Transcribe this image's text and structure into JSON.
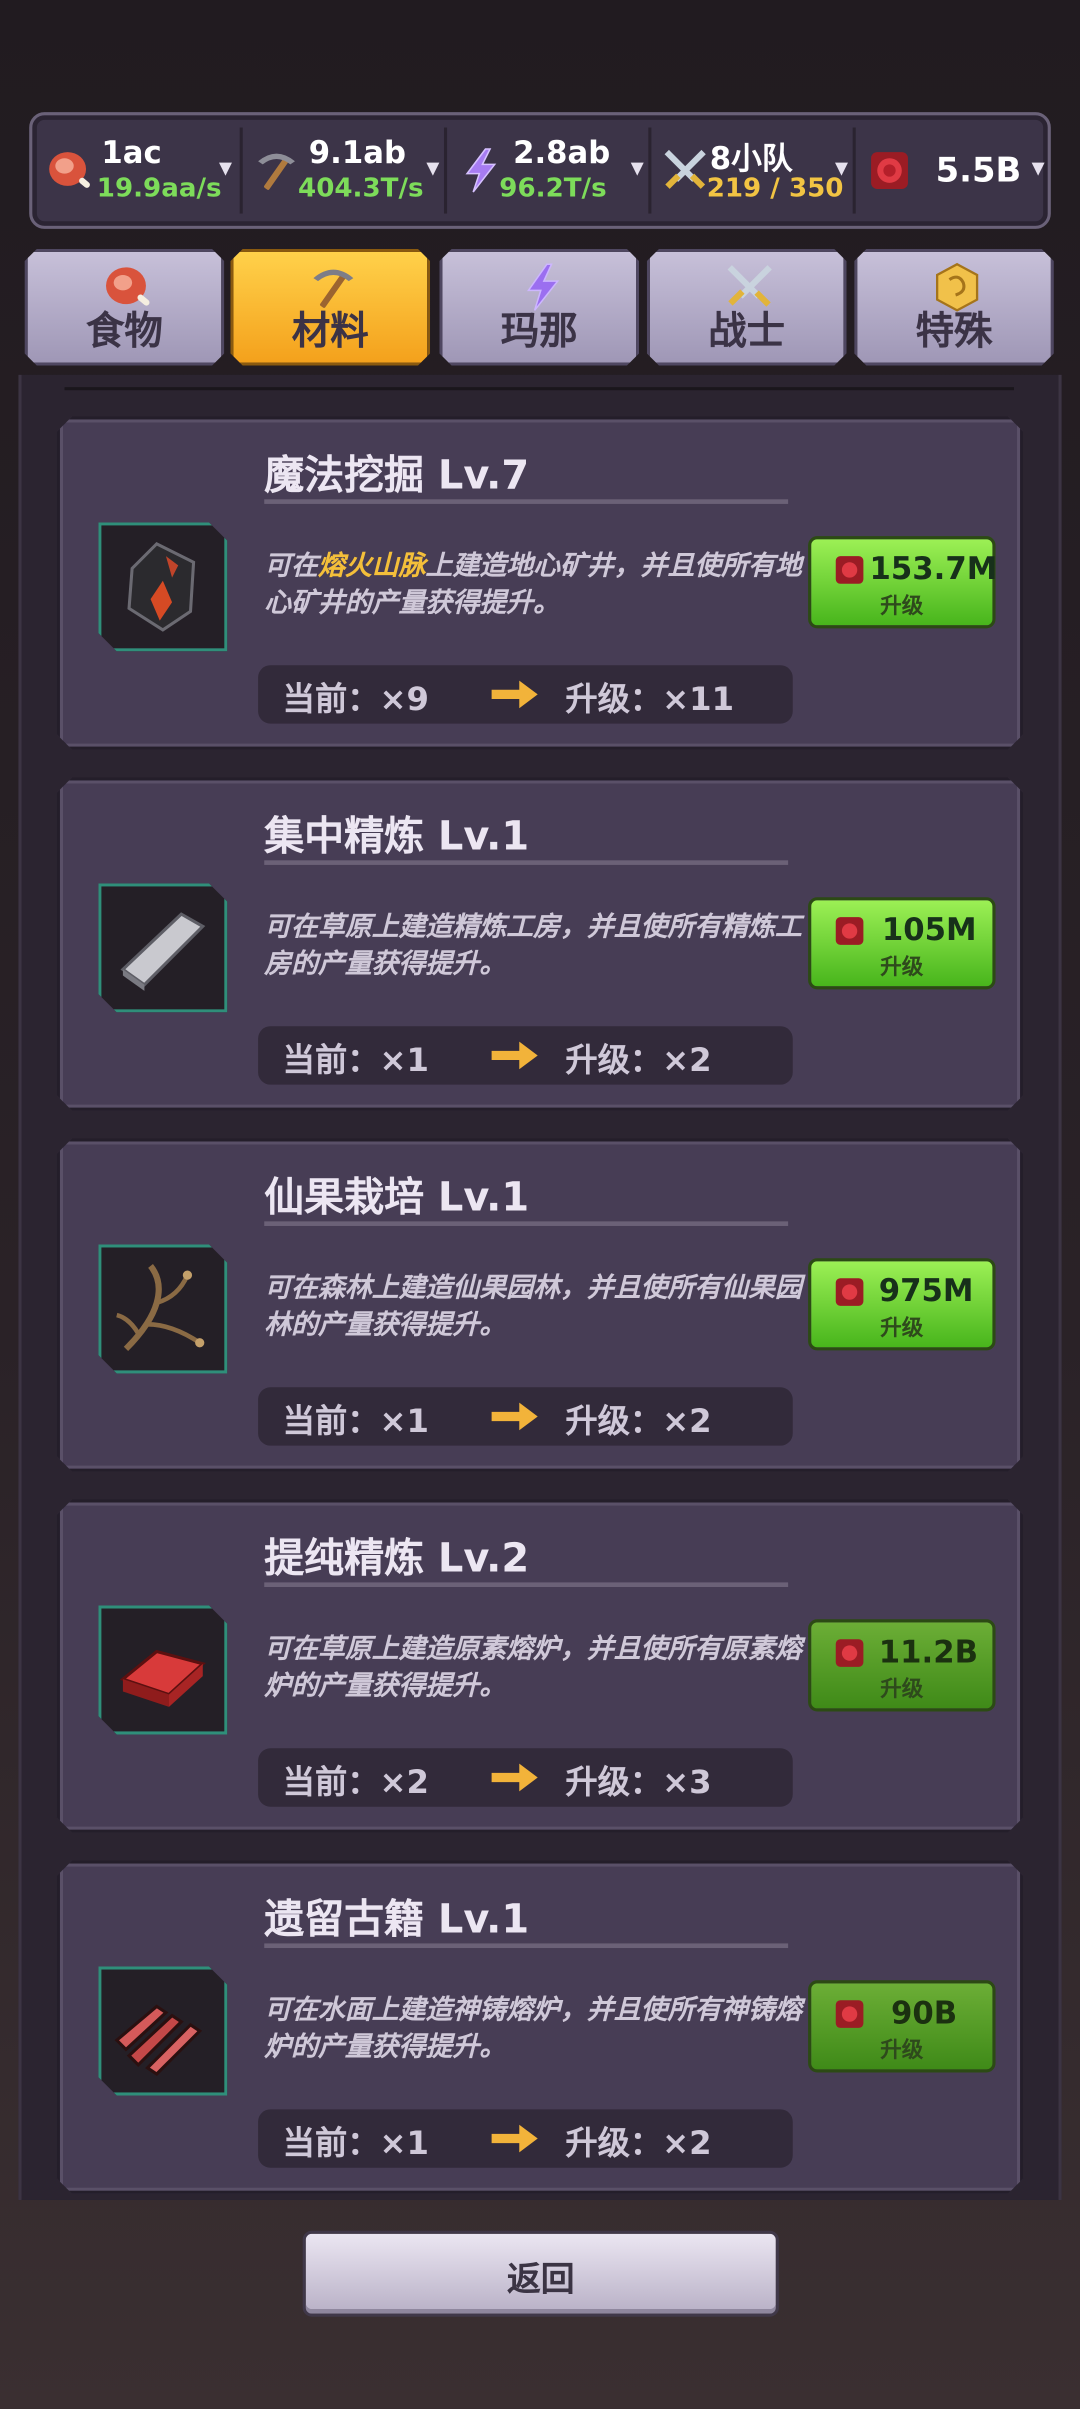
{
  "resources": [
    {
      "icon": "meat-icon",
      "amount": "1ac",
      "rate": "19.9aa/s",
      "rate_color": "#7ddc5a"
    },
    {
      "icon": "pickaxe-icon",
      "amount": "9.1ab",
      "rate": "404.3T/s",
      "rate_color": "#7ddc5a"
    },
    {
      "icon": "lightning-icon",
      "amount": "2.8ab",
      "rate": "96.2T/s",
      "rate_color": "#7ddc5a"
    },
    {
      "icon": "crossed-swords-icon",
      "amount": "8小队",
      "rate": "219 / 350",
      "rate_color": "#f2c443"
    },
    {
      "icon": "red-gem-icon",
      "amount": "5.5B",
      "rate": "",
      "rate_color": "#7ddc5a"
    }
  ],
  "tabs": [
    {
      "icon": "meat-icon",
      "label": "食物",
      "active": false
    },
    {
      "icon": "pickaxe-icon",
      "label": "材料",
      "active": true
    },
    {
      "icon": "lightning-icon",
      "label": "玛那",
      "active": false
    },
    {
      "icon": "crossed-swords-icon",
      "label": "战士",
      "active": false
    },
    {
      "icon": "gold-coin-icon",
      "label": "特殊",
      "active": false
    }
  ],
  "upgrades": [
    {
      "title": "魔法挖掘 Lv.7",
      "icon": "black-ore-icon",
      "desc_pre": "可在",
      "desc_highlight": "熔火山脉",
      "desc_post": "上建造地心矿井，并且使所有地心矿井的产量获得提升。",
      "current": "当前：×9",
      "next": "升级：×11",
      "price": "153.7M",
      "button_label": "升级",
      "affordable": true
    },
    {
      "title": "集中精炼 Lv.1",
      "icon": "metal-bar-icon",
      "desc_pre": "可在草原上建造精炼工房，并且使所有精炼工房的产量获得提升。",
      "desc_highlight": "",
      "desc_post": "",
      "current": "当前：×1",
      "next": "升级：×2",
      "price": "105M",
      "button_label": "升级",
      "affordable": true
    },
    {
      "title": "仙果栽培 Lv.1",
      "icon": "branch-icon",
      "desc_pre": "可在森林上建造仙果园林，并且使所有仙果园林的产量获得提升。",
      "desc_highlight": "",
      "desc_post": "",
      "current": "当前：×1",
      "next": "升级：×2",
      "price": "975M",
      "button_label": "升级",
      "affordable": true
    },
    {
      "title": "提纯精炼 Lv.2",
      "icon": "red-ingot-icon",
      "desc_pre": "可在草原上建造原素熔炉，并且使所有原素熔炉的产量获得提升。",
      "desc_highlight": "",
      "desc_post": "",
      "current": "当前：×2",
      "next": "升级：×3",
      "price": "11.2B",
      "button_label": "升级",
      "affordable": false
    },
    {
      "title": "遗留古籍 Lv.1",
      "icon": "red-bars-icon",
      "desc_pre": "可在水面上建造神铸熔炉，并且使所有神铸熔炉的产量获得提升。",
      "desc_highlight": "",
      "desc_post": "",
      "current": "当前：×1",
      "next": "升级：×2",
      "price": "90B",
      "button_label": "升级",
      "affordable": false
    }
  ],
  "back_label": "返回"
}
